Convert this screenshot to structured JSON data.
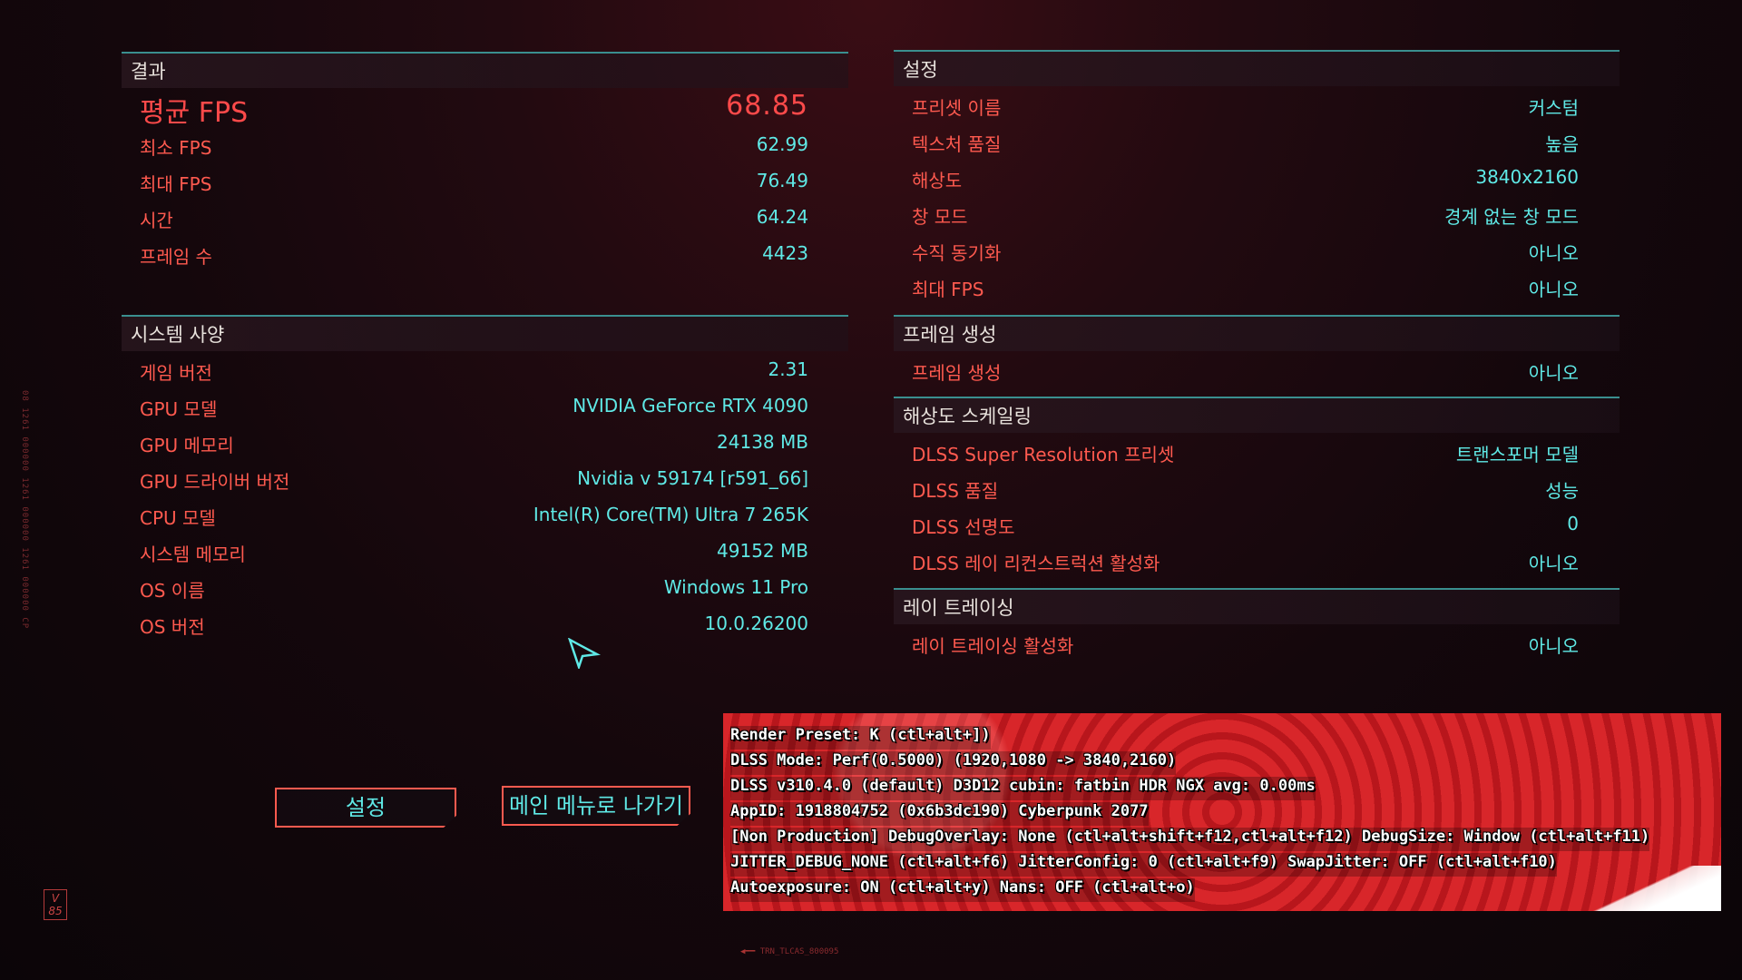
{
  "results": {
    "title": "결과",
    "avg_fps_label": "평균 FPS",
    "avg_fps_value": "68.85",
    "rows": [
      {
        "label": "최소 FPS",
        "value": "62.99"
      },
      {
        "label": "최대 FPS",
        "value": "76.49"
      },
      {
        "label": "시간",
        "value": "64.24"
      },
      {
        "label": "프레임 수",
        "value": "4423"
      }
    ]
  },
  "system": {
    "title": "시스템 사양",
    "rows": [
      {
        "label": "게임 버전",
        "value": "2.31"
      },
      {
        "label": "GPU 모델",
        "value": "NVIDIA GeForce RTX 4090"
      },
      {
        "label": "GPU 메모리",
        "value": "24138 MB"
      },
      {
        "label": "GPU 드라이버 버전",
        "value": "Nvidia v 59174 [r591_66]"
      },
      {
        "label": "CPU 모델",
        "value": "Intel(R) Core(TM) Ultra 7 265K"
      },
      {
        "label": "시스템 메모리",
        "value": "49152 MB"
      },
      {
        "label": "OS 이름",
        "value": "Windows 11 Pro"
      },
      {
        "label": "OS 버전",
        "value": "10.0.26200"
      }
    ]
  },
  "settings": {
    "title": "설정",
    "rows": [
      {
        "label": "프리셋 이름",
        "value": "커스텀"
      },
      {
        "label": "텍스처 품질",
        "value": "높음"
      },
      {
        "label": "해상도",
        "value": "3840x2160"
      },
      {
        "label": "창 모드",
        "value": "경계 없는 창 모드"
      },
      {
        "label": "수직 동기화",
        "value": "아니오"
      },
      {
        "label": "최대 FPS",
        "value": "아니오"
      }
    ]
  },
  "frame_gen": {
    "title": "프레임 생성",
    "rows": [
      {
        "label": "프레임 생성",
        "value": "아니오"
      }
    ]
  },
  "scaling": {
    "title": "해상도 스케일링",
    "rows": [
      {
        "label": "DLSS Super Resolution 프리셋",
        "value": "트랜스포머 모델"
      },
      {
        "label": "DLSS 품질",
        "value": "성능"
      },
      {
        "label": "DLSS 선명도",
        "value": "0"
      },
      {
        "label": "DLSS 레이 리컨스트럭션 활성화",
        "value": "아니오"
      }
    ]
  },
  "raytracing": {
    "title": "레이 트레이싱",
    "rows": [
      {
        "label": "레이 트레이싱 활성화",
        "value": "아니오"
      }
    ]
  },
  "buttons": {
    "settings": "설정",
    "main_menu": "메인 메뉴로 나가기"
  },
  "dlss_overlay": [
    "Render Preset: K (ctl+alt+])",
    "DLSS Mode: Perf(0.5000) (1920,1080 -> 3840,2160)",
    "DLSS v310.4.0 (default) D3D12 cubin: fatbin HDR NGX avg: 0.00ms",
    "AppID: 1918804752 (0x6b3dc190) Cyberpunk 2077",
    "[Non Production] DebugOverlay: None (ctl+alt+shift+f12,ctl+alt+f12) DebugSize: Window (ctl+alt+f11)",
    "JITTER_DEBUG_NONE (ctl+alt+f6) JitterConfig: 0 (ctl+alt+f9) SwapJitter: OFF (ctl+alt+f10)",
    "Autoexposure: ON (ctl+alt+y) Nans: OFF (ctl+alt+o)"
  ],
  "badge": "V 85",
  "footer_code": "TRN_TLCAS_800095",
  "side_code": "08 1261 000000 1261 000000 1261 000000 CP",
  "colors": {
    "label": "#ff5a4f",
    "value": "#5fe9e6",
    "accent": "#3a8f8f"
  }
}
